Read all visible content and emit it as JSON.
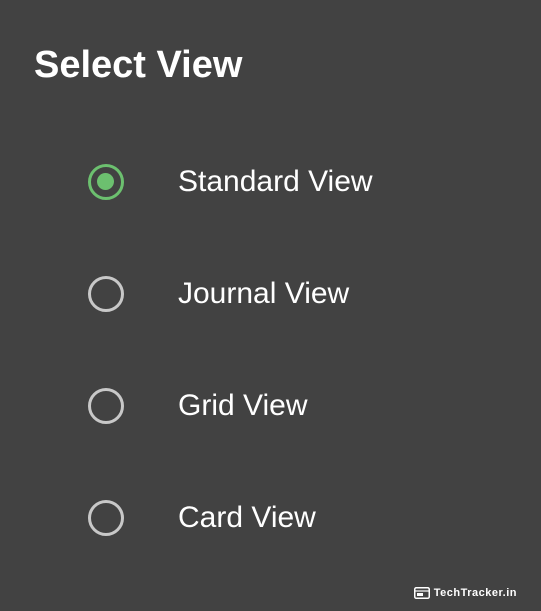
{
  "dialog": {
    "title": "Select View",
    "selected_index": 0,
    "accent_color": "#6cc06f",
    "background_color": "#424242",
    "options": [
      {
        "label": "Standard View",
        "checked": true
      },
      {
        "label": "Journal View",
        "checked": false
      },
      {
        "label": "Grid View",
        "checked": false
      },
      {
        "label": "Card View",
        "checked": false
      }
    ]
  },
  "watermark": {
    "text": "TechTracker.in",
    "icon": "browser-window-icon"
  }
}
